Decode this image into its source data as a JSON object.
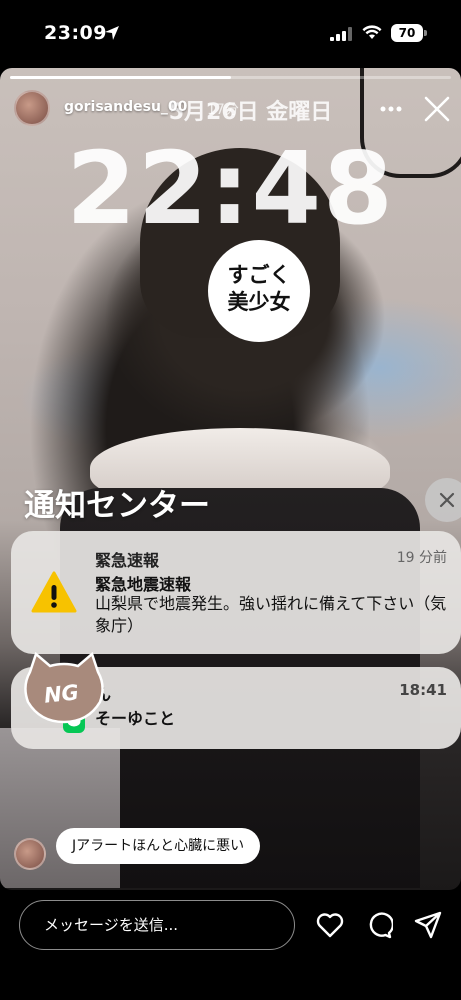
{
  "status_bar": {
    "time": "23:09",
    "battery": "70"
  },
  "story": {
    "progress": 0.5,
    "username": "gorisandesu_00",
    "elapsed": "17分"
  },
  "lock_screen": {
    "date": "5月26日 金曜日",
    "time": "22:48"
  },
  "face_sticker": {
    "line1": "すごく",
    "line2": "美少女"
  },
  "notification_center": {
    "title": "通知センター",
    "notifications": [
      {
        "app": "緊急速報",
        "time": "19 分前",
        "title": "緊急地震速報",
        "body": "山梨県で地震発生。強い揺れに備えて下さい（気象庁）"
      },
      {
        "app": "ん",
        "time": "18:41",
        "body": "そーゆこと"
      }
    ]
  },
  "ng_sticker": {
    "text": "NG"
  },
  "comment": {
    "text": "Jアラートほんと心臓に悪い"
  },
  "bottom_bar": {
    "placeholder": "メッセージを送信..."
  },
  "colors": {
    "line_green": "#06c755",
    "warning_yellow": "#f7c200"
  }
}
